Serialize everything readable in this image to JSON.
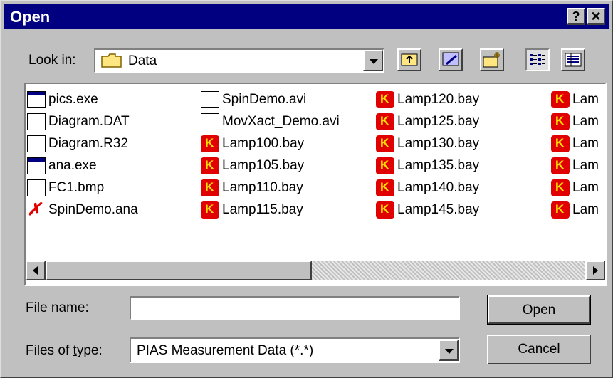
{
  "dialog": {
    "title": "Open",
    "help_label": "?",
    "close_label": "✕"
  },
  "lookin": {
    "label_pre": "Look ",
    "label_mnemonic": "i",
    "label_post": "n:",
    "value": "Data"
  },
  "toolbar": {
    "up_one_level_icon": "folder-up-icon",
    "desktop_icon": "desktop-icon",
    "new_folder_icon": "new-folder-icon",
    "list_view_icon": "list-view-icon",
    "details_view_icon": "details-view-icon"
  },
  "files": {
    "col1": [
      {
        "name": "pics.exe",
        "icon": "exe"
      },
      {
        "name": "Diagram.DAT",
        "icon": "dat"
      },
      {
        "name": "Diagram.R32",
        "icon": "r32"
      },
      {
        "name": "ana.exe",
        "icon": "exe"
      },
      {
        "name": "FC1.bmp",
        "icon": "bmp"
      },
      {
        "name": "SpinDemo.ana",
        "icon": "ana"
      }
    ],
    "col2": [
      {
        "name": "SpinDemo.avi",
        "icon": "avi"
      },
      {
        "name": "MovXact_Demo.avi",
        "icon": "avi"
      },
      {
        "name": "Lamp100.bay",
        "icon": "bay"
      },
      {
        "name": "Lamp105.bay",
        "icon": "bay"
      },
      {
        "name": "Lamp110.bay",
        "icon": "bay"
      },
      {
        "name": "Lamp115.bay",
        "icon": "bay"
      }
    ],
    "col3": [
      {
        "name": "Lamp120.bay",
        "icon": "bay"
      },
      {
        "name": "Lamp125.bay",
        "icon": "bay"
      },
      {
        "name": "Lamp130.bay",
        "icon": "bay"
      },
      {
        "name": "Lamp135.bay",
        "icon": "bay"
      },
      {
        "name": "Lamp140.bay",
        "icon": "bay"
      },
      {
        "name": "Lamp145.bay",
        "icon": "bay"
      }
    ],
    "col4": [
      {
        "name": "Lam",
        "icon": "bay"
      },
      {
        "name": "Lam",
        "icon": "bay"
      },
      {
        "name": "Lam",
        "icon": "bay"
      },
      {
        "name": "Lam",
        "icon": "bay"
      },
      {
        "name": "Lam",
        "icon": "bay"
      },
      {
        "name": "Lam",
        "icon": "bay"
      }
    ]
  },
  "filename": {
    "label_pre": "File ",
    "label_mnemonic": "n",
    "label_post": "ame:",
    "value": ""
  },
  "filetype": {
    "label_pre": "Files of ",
    "label_mnemonic": "t",
    "label_post": "ype:",
    "value": "PIAS Measurement Data (*.*)"
  },
  "buttons": {
    "open_mnemonic": "O",
    "open_rest": "pen",
    "cancel": "Cancel"
  },
  "colors": {
    "titlebar": "#000080",
    "face": "#c0c0c0",
    "bay_icon": "#e00000"
  }
}
